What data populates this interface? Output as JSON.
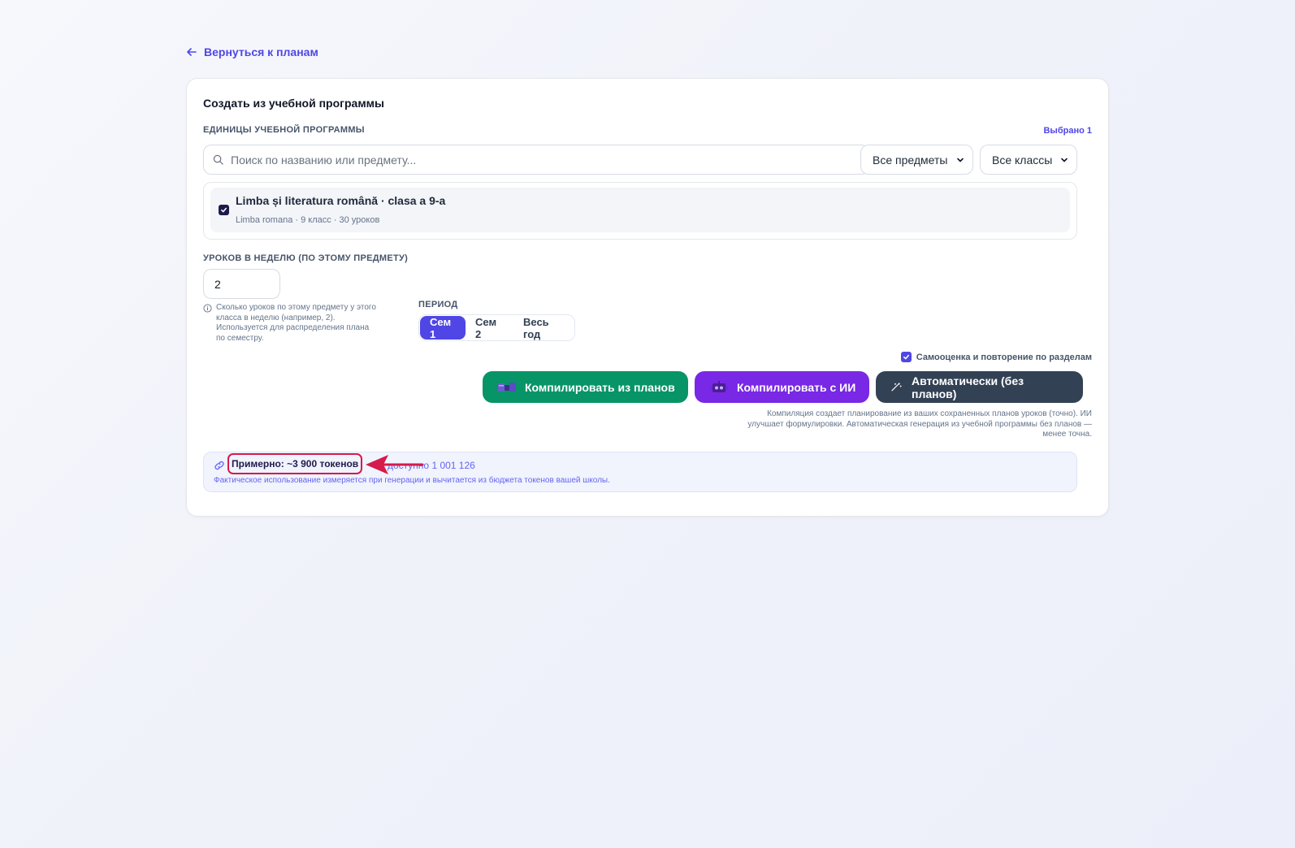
{
  "back_link": {
    "label": "Вернуться к планам"
  },
  "card": {
    "title": "Создать из учебной программы",
    "units_label": "ЕДИНИЦЫ УЧЕБНОЙ ПРОГРАММЫ",
    "selected_count": "Выбрано 1",
    "search": {
      "placeholder": "Поиск по названию или предмету...",
      "value": ""
    },
    "subject_filter": {
      "selected": "Все предметы"
    },
    "class_filter": {
      "selected": "Все классы"
    },
    "items": [
      {
        "title": "Limba și literatura română · clasa a 9-a",
        "meta": "Limba romana · 9 класс · 30 уроков",
        "checked": true
      }
    ],
    "lessons_per_week": {
      "label": "УРОКОВ В НЕДЕЛЮ (ПО ЭТОМУ ПРЕДМЕТУ)",
      "value": "2",
      "hint": "Сколько уроков по этому предмету у этого класса в неделю (например, 2). Используется для распределения плана по семестру."
    },
    "period": {
      "label": "ПЕРИОД",
      "options": [
        "Сем 1",
        "Сем 2",
        "Весь год"
      ],
      "selected": "Сем 1"
    },
    "self_assessment": {
      "label": "Самооценка и повторение по разделам",
      "checked": true
    },
    "actions": {
      "compile_plans": "Компилировать из планов",
      "compile_ai": "Компилировать с ИИ",
      "auto": "Автоматически (без планов)"
    },
    "note": "Компиляция создает планирование из ваших сохраненных планов уроков (точно). ИИ улучшает формулировки. Автоматическая генерация из учебной программы без планов — менее точна.",
    "tokens": {
      "estimate": "Примерно: ~3 900 токенов",
      "available": "доступно 1 001 126",
      "description": "Фактическое использование измеряется при генерации и вычитается из бюджета токенов вашей школы."
    }
  },
  "colors": {
    "accent": "#4f46e5",
    "green": "#079467",
    "purple": "#7928e5",
    "dark": "#334155",
    "highlight": "#d41b4b"
  }
}
